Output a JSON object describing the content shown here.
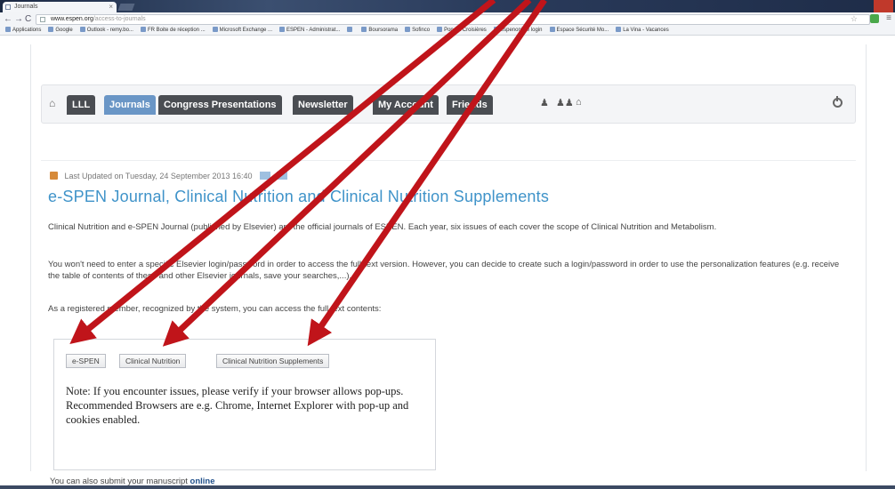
{
  "browser": {
    "tab_title": "Journals",
    "url_host": "www.espen.org",
    "url_path": "/access-to-journals",
    "bookmarks": [
      "Applications",
      "Google",
      "Outlook - remy.bo...",
      "FR Boite de réception ...",
      "Microsoft Exchange ...",
      "ESPEN - Administrat...",
      "",
      "Boursorama",
      "Sofinco",
      "Ponant Croisières",
      "espenonline login",
      "Espace Sécurité Mo...",
      "La Vina - Vacances"
    ]
  },
  "site_nav": {
    "home_icon": "home-icon",
    "items": [
      "LLL",
      "Journals",
      "Congress Presentations",
      "Newsletter",
      "My Account",
      "Friends"
    ],
    "active": "Journals",
    "active_color": "#6a96c6",
    "tab_color": "#4a4d52",
    "extra_icons": [
      "bell-icon",
      "users-icon",
      "inbox-icon"
    ],
    "logout_icon": "power-icon"
  },
  "article": {
    "meta": "Last Updated on Tuesday, 24 September 2013 16:40",
    "title": "e-SPEN Journal, Clinical Nutrition and Clinical Nutrition Supplements",
    "title_color": "#3f93c9",
    "paragraphs": [
      "Clinical Nutrition and e-SPEN Journal (published by Elsevier) are the official journals of ESPEN. Each year, six issues of each cover the scope of Clinical Nutrition and Metabolism.",
      "You won't need to enter a specific Elsevier login/password in order to access the full-text version. However, you can decide to create such a login/password in order to use the personalization features (e.g. receive the table of contents of these and other Elsevier journals, save your searches,...).",
      "As a registered member, recognized by the system, you can access the full text contents:"
    ],
    "journal_buttons": [
      "e-SPEN",
      "Clinical Nutrition",
      "Clinical Nutrition Supplements"
    ],
    "note": "Note: If you encounter issues, please verify if your browser allows pop-ups. Recommended Browsers are e.g. Chrome, Internet Explorer with pop-up and cookies enabled.",
    "submit_text": "You can also submit your manuscript",
    "submit_link": "online"
  },
  "annotation": {
    "arrow_color": "#c0141a"
  }
}
